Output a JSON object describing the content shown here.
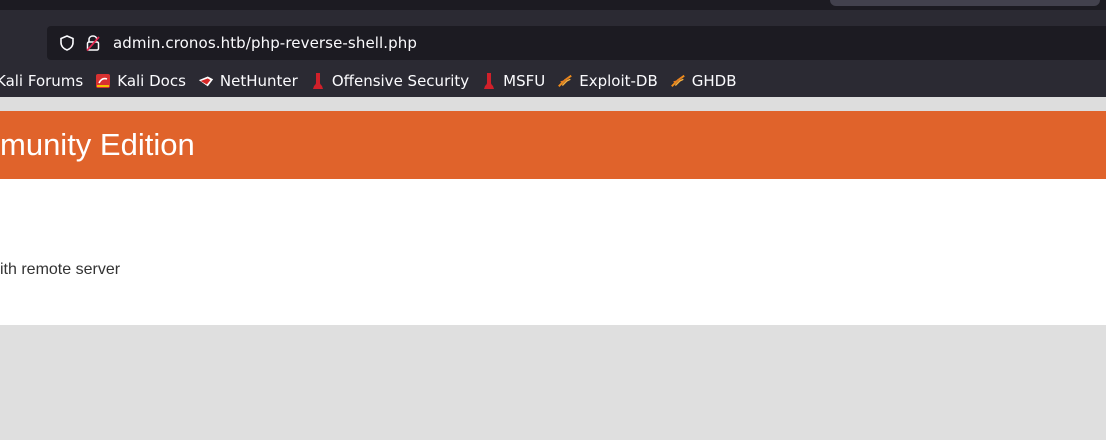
{
  "browser": {
    "url": "admin.cronos.htb/php-reverse-shell.php",
    "bookmarks": [
      {
        "label": "Kali Forums",
        "icon": "kali-forums-icon"
      },
      {
        "label": "Kali Docs",
        "icon": "kali-docs-icon"
      },
      {
        "label": "NetHunter",
        "icon": "nethunter-icon"
      },
      {
        "label": "Offensive Security",
        "icon": "offsec-icon"
      },
      {
        "label": "MSFU",
        "icon": "offsec-icon"
      },
      {
        "label": "Exploit-DB",
        "icon": "exploit-db-icon"
      },
      {
        "label": "GHDB",
        "icon": "exploit-db-icon"
      }
    ]
  },
  "page": {
    "header_title": "munity Edition",
    "message": "ith remote server"
  },
  "colors": {
    "header_orange": "#e0632b",
    "chrome_dark": "#2b2a33",
    "urlbar_bg": "#1c1b22"
  }
}
